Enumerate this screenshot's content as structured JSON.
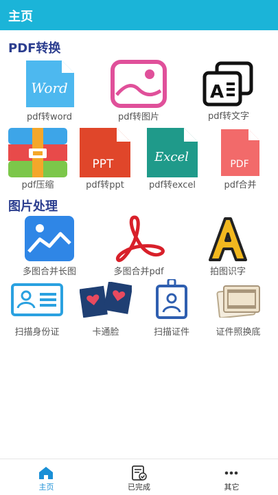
{
  "header": {
    "title": "主页"
  },
  "sections": [
    {
      "title": "PDF转换"
    },
    {
      "title": "图片处理"
    }
  ],
  "pdf_tools": [
    {
      "label": "pdf转word",
      "icon": "word-doc-icon",
      "icon_text": "Word"
    },
    {
      "label": "pdf转图片",
      "icon": "image-frame-icon"
    },
    {
      "label": "pdf转文字",
      "icon": "text-ocr-icon",
      "icon_text": "A"
    },
    {
      "label": "pdf压缩",
      "icon": "archive-compress-icon"
    },
    {
      "label": "pdf转ppt",
      "icon": "ppt-doc-icon",
      "icon_text": "PPT"
    },
    {
      "label": "pdf转excel",
      "icon": "excel-doc-icon",
      "icon_text": "Excel"
    },
    {
      "label": "pdf合并",
      "icon": "pdf-doc-icon",
      "icon_text": "PDF"
    }
  ],
  "image_tools": [
    {
      "label": "多图合并长图",
      "icon": "landscape-image-icon"
    },
    {
      "label": "多图合并pdf",
      "icon": "acrobat-icon"
    },
    {
      "label": "拍图识字",
      "icon": "letter-a-icon",
      "icon_text": "A"
    },
    {
      "label": "扫描身份证",
      "icon": "id-card-icon"
    },
    {
      "label": "卡通脸",
      "icon": "film-hearts-icon"
    },
    {
      "label": "扫描证件",
      "icon": "badge-icon"
    },
    {
      "label": "证件照换底",
      "icon": "photo-stack-icon"
    }
  ],
  "tabbar": {
    "items": [
      {
        "label": "主页",
        "icon": "home-icon",
        "active": true
      },
      {
        "label": "已完成",
        "icon": "checklist-icon",
        "active": false
      },
      {
        "label": "其它",
        "icon": "more-dots-icon",
        "active": false
      }
    ]
  },
  "colors": {
    "header_bg": "#1bb4d8",
    "section_title": "#2c3e8f",
    "active_tab": "#1a8fd6"
  }
}
